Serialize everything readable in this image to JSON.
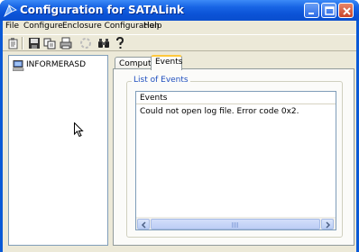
{
  "window": {
    "title": "Configuration for SATALink",
    "accent": "#0a59d6"
  },
  "menu": {
    "items": [
      {
        "label": "File"
      },
      {
        "label": "Configure"
      },
      {
        "label": "Enclosure Configuration"
      },
      {
        "label": "Help"
      }
    ]
  },
  "toolbar": {
    "icons": [
      "properties-icon",
      "save-icon",
      "copy-icon",
      "print-icon",
      "refresh-icon",
      "find-icon",
      "help-icon"
    ]
  },
  "tree": {
    "nodes": [
      {
        "label": "INFORMERASD",
        "icon": "computer-icon"
      }
    ]
  },
  "tabs": [
    {
      "label": "Computer",
      "active": false
    },
    {
      "label": "Events",
      "active": true
    }
  ],
  "events": {
    "group_label": "List of Events",
    "column_header": "Events",
    "rows": [
      "Could not open log file. Error code 0x2."
    ]
  },
  "scrollbar": {
    "grip": "III"
  }
}
